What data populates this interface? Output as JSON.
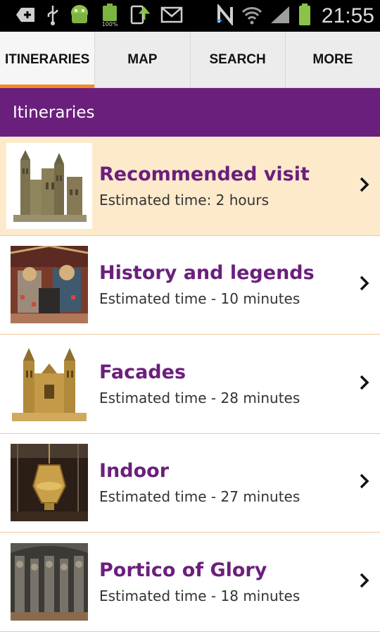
{
  "status_bar": {
    "time": "21:55",
    "icons": [
      "add-icon",
      "usb-icon",
      "android-icon",
      "battery-100-icon",
      "download-icon",
      "mail-icon",
      "nfc-icon",
      "wifi-icon",
      "signal-icon",
      "battery-icon"
    ],
    "battery_small_label": "100%"
  },
  "tabs": [
    {
      "label": "ITINERARIES",
      "active": true
    },
    {
      "label": "MAP",
      "active": false
    },
    {
      "label": "SEARCH",
      "active": false
    },
    {
      "label": "MORE",
      "active": false
    }
  ],
  "section": {
    "title": "Itineraries"
  },
  "itineraries": [
    {
      "title": "Recommended visit",
      "subtitle": "Estimated time: 2 hours",
      "thumb": "cathedral-towers-image",
      "selected": true
    },
    {
      "title": "History and legends",
      "subtitle": "Estimated time - 10 minutes",
      "thumb": "mosaic-image",
      "selected": false
    },
    {
      "title": "Facades",
      "subtitle": "Estimated time - 28 minutes",
      "thumb": "facade-image",
      "selected": false
    },
    {
      "title": "Indoor",
      "subtitle": "Estimated time - 27 minutes",
      "thumb": "censer-image",
      "selected": false
    },
    {
      "title": "Portico of Glory",
      "subtitle": "Estimated time - 18 minutes",
      "thumb": "portico-image",
      "selected": false
    }
  ],
  "colors": {
    "accent_purple": "#6b1f7c",
    "tab_indicator": "#f58a21",
    "selected_row": "#fdeacb",
    "divider": "#f2c69a"
  }
}
